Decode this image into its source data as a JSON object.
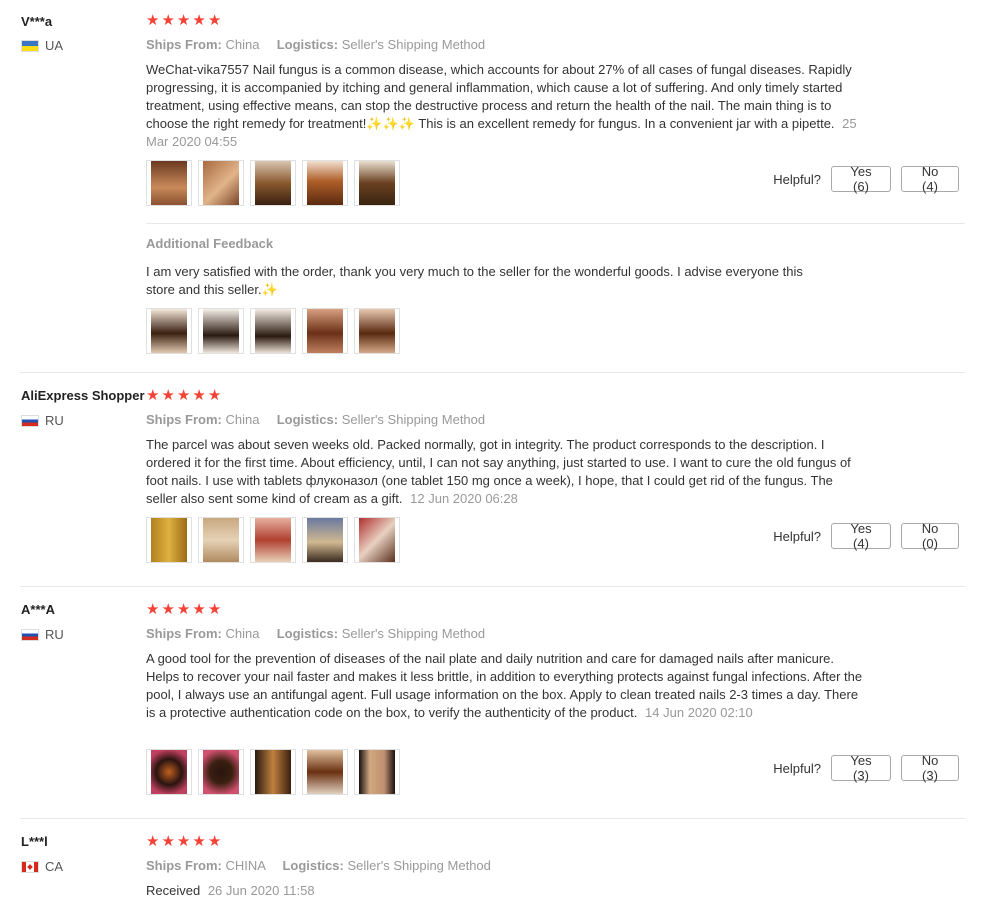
{
  "reviews": [
    {
      "user": "V***a",
      "country": "UA",
      "ships_from_label": "Ships From:",
      "ships_from": "China",
      "logistics_label": "Logistics:",
      "logistics": "Seller's Shipping Method",
      "text": "WeChat-vika7557 Nail fungus is a common disease, which accounts for about 27% of all cases of fungal diseases. Rapidly progressing, it is accompanied by itching and general inflammation, which cause a lot of suffering. And only timely started treatment, using effective means, can stop the destructive process and return the health of the nail. The main thing is to choose the right remedy for treatment!✨✨✨ This is an excellent remedy for fungus. In a convenient jar with a pipette.",
      "date": "25 Mar 2020 04:55",
      "helpful_label": "Helpful?",
      "yes_label": "Yes (6)",
      "no_label": "No (4)",
      "additional_label": "Additional Feedback",
      "additional_text": "I am very satisfied with the order, thank you very much to the seller for the wonderful goods. I advise everyone this store and this seller.✨"
    },
    {
      "user": "AliExpress Shopper",
      "country": "RU",
      "ships_from_label": "Ships From:",
      "ships_from": "China",
      "logistics_label": "Logistics:",
      "logistics": "Seller's Shipping Method",
      "text": "The parcel was about seven weeks old. Packed normally, got in integrity. The product corresponds to the description. I ordered it for the first time. About efficiency, until, I can not say anything, just started to use. I want to cure the old fungus of foot nails. I use with tablets флуконазол (one tablet 150 mg once a week), I hope, that I could get rid of the fungus. The seller also sent some kind of cream as a gift.",
      "date": "12 Jun 2020 06:28",
      "helpful_label": "Helpful?",
      "yes_label": "Yes (4)",
      "no_label": "No (0)"
    },
    {
      "user": "A***A",
      "country": "RU",
      "ships_from_label": "Ships From:",
      "ships_from": "China",
      "logistics_label": "Logistics:",
      "logistics": "Seller's Shipping Method",
      "text": "A good tool for the prevention of diseases of the nail plate and daily nutrition and care for damaged nails after manicure. Helps to recover your nail faster and makes it less brittle, in addition to everything protects against fungal infections. After the pool, I always use an antifungal agent. Full usage information on the box. Apply to clean treated nails 2-3 times a day. There is a protective authentication code on the box, to verify the authenticity of the product.",
      "date": "14 Jun 2020 02:10",
      "helpful_label": "Helpful?",
      "yes_label": "Yes (3)",
      "no_label": "No (3)"
    },
    {
      "user": "L***l",
      "country": "CA",
      "ships_from_label": "Ships From:",
      "ships_from": "CHINA",
      "logistics_label": "Logistics:",
      "logistics": "Seller's Shipping Method",
      "text": "Received",
      "date": "26 Jun 2020 11:58"
    }
  ],
  "colors": {
    "star": "#f44336",
    "muted": "#999999",
    "border": "#aaaaaa"
  },
  "icons": {
    "star": "star-icon",
    "flag": "country-flag-icon",
    "thumbnail": "review-photo-thumbnail"
  }
}
